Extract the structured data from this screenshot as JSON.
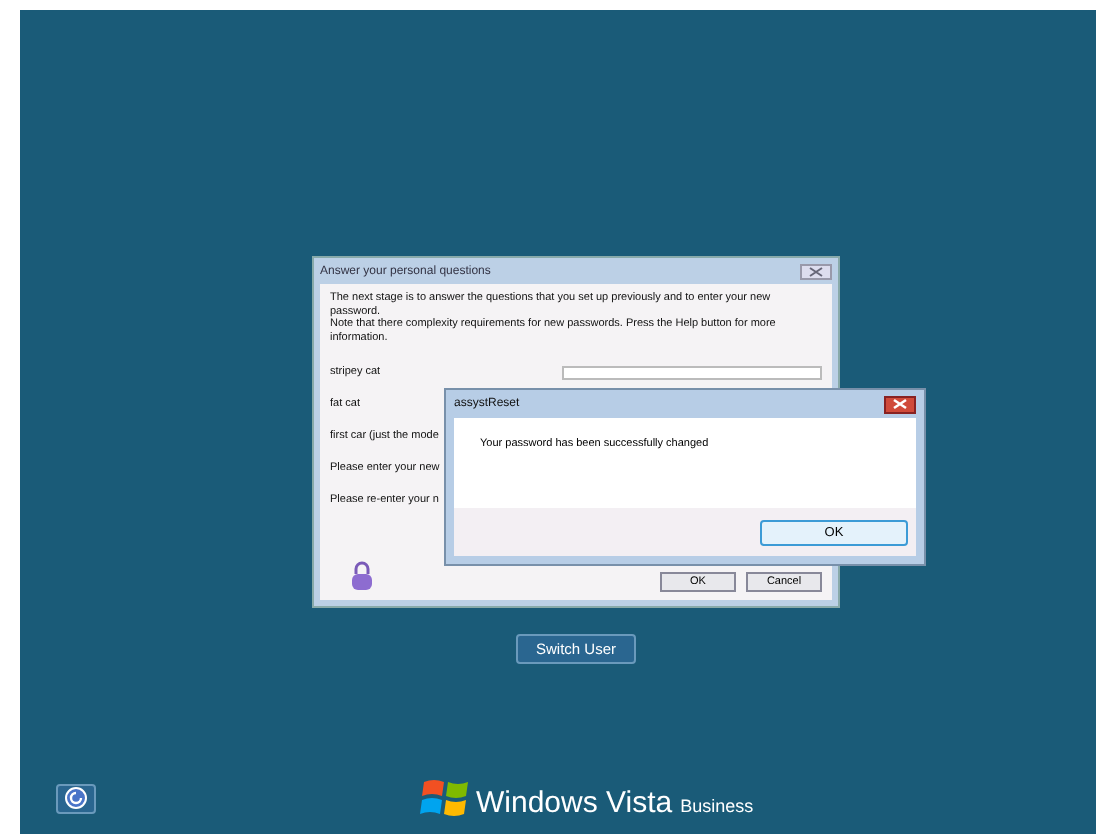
{
  "back_dialog": {
    "title": "Answer your personal questions",
    "intro": [
      "The next stage is to answer the questions that you set up previously and to enter your new password.",
      "Note that there complexity requirements for new passwords. Press the Help button for more information."
    ],
    "rows": [
      {
        "label": "stripey cat",
        "kind": "field"
      },
      {
        "label": "fat cat",
        "kind": "label"
      },
      {
        "label": "first car (just the mode",
        "kind": "label"
      },
      {
        "label": "Please enter your new",
        "kind": "label"
      },
      {
        "label": "Please re-enter your n",
        "kind": "label"
      }
    ],
    "buttons": [
      "OK",
      "Cancel"
    ]
  },
  "message_box": {
    "title": "assystReset",
    "message": "Your password has been successfully changed",
    "button": "OK"
  },
  "switch_user": "Switch User",
  "branding": {
    "product": "Windows Vista",
    "edition": "Business"
  }
}
